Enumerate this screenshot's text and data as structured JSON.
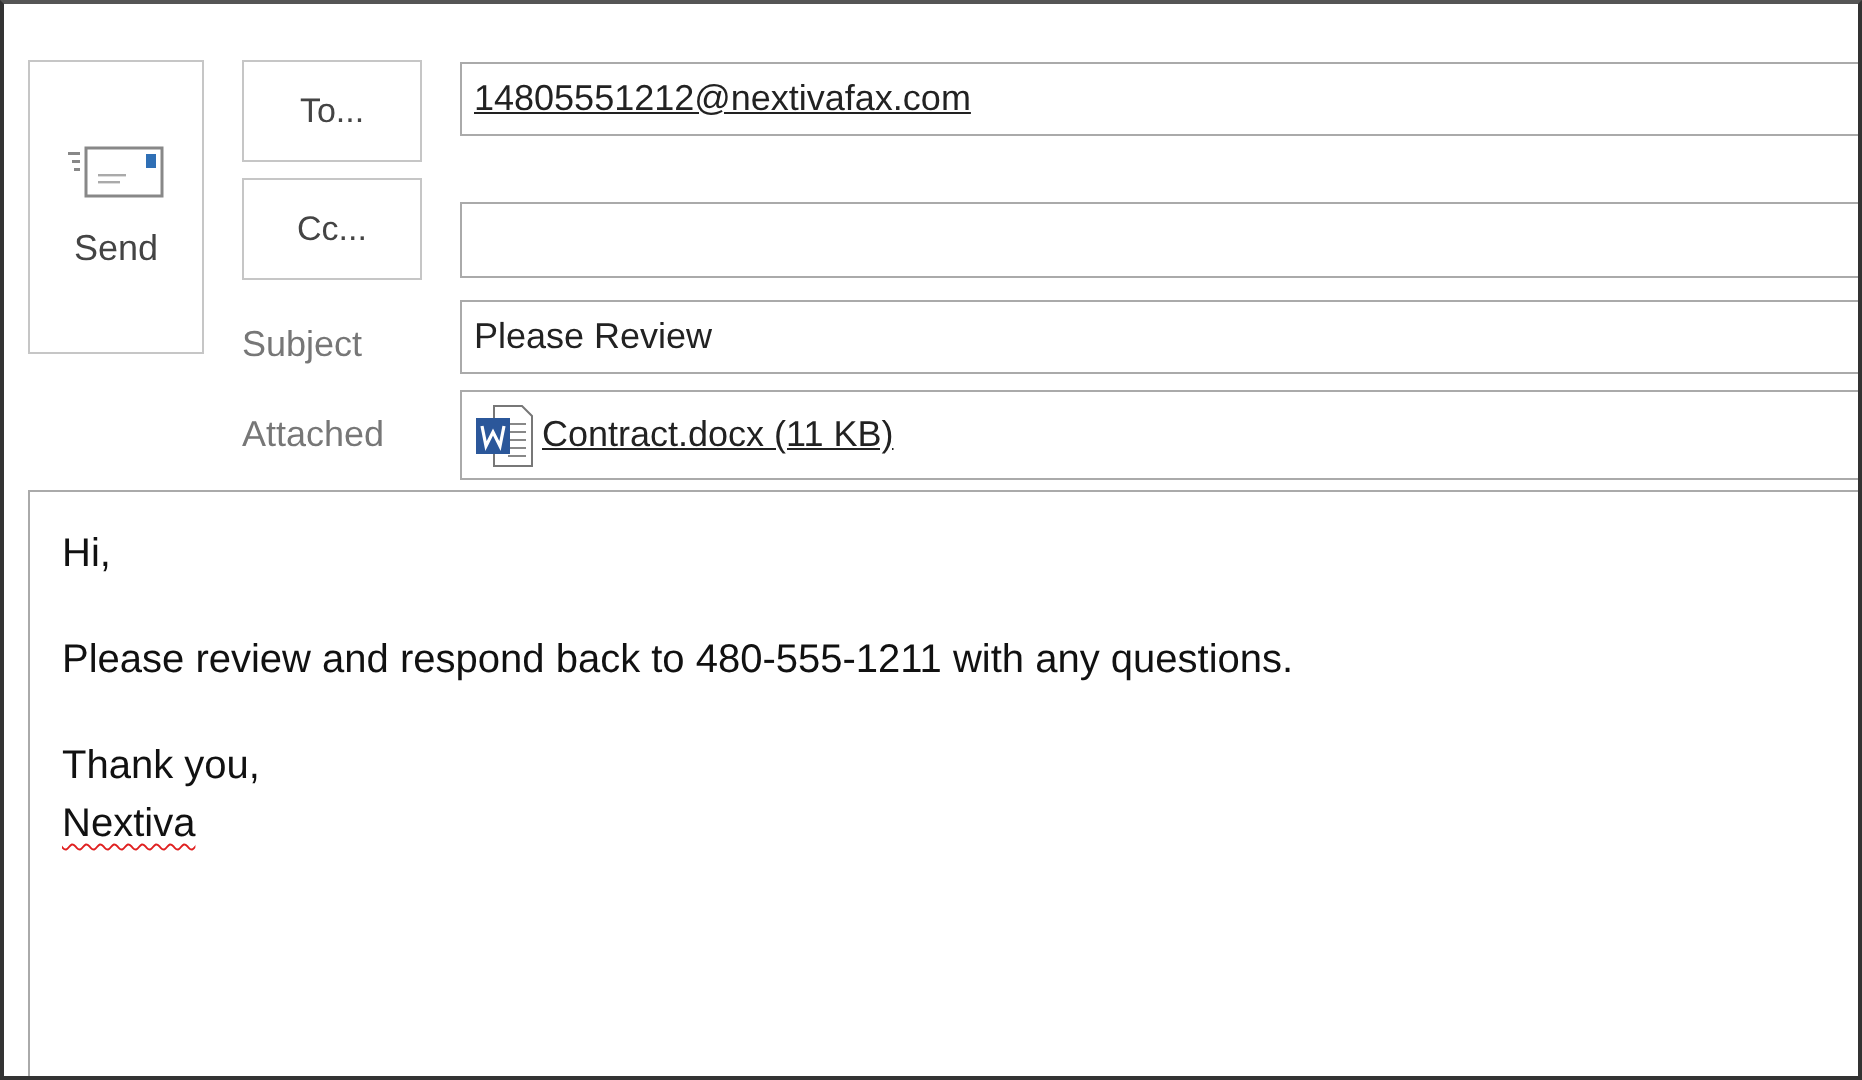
{
  "send_button": {
    "label": "Send"
  },
  "to_button": {
    "label": "To..."
  },
  "to_field": {
    "value": "14805551212@nextivafax.com"
  },
  "cc_button": {
    "label": "Cc..."
  },
  "subject": {
    "label": "Subject",
    "value": "Please Review"
  },
  "attachment": {
    "label": "Attached",
    "file": "Contract.docx (11 KB)"
  },
  "body": {
    "paragraphs": [
      [
        {
          "text": "Hi,",
          "misspelled": false
        }
      ],
      [
        {
          "text": "Please review and respond back to 480-555-1211 with any questions.",
          "misspelled": false
        }
      ],
      [
        {
          "text": "Thank you,",
          "misspelled": false
        },
        {
          "text": "Nextiva",
          "misspelled": true
        }
      ]
    ]
  }
}
